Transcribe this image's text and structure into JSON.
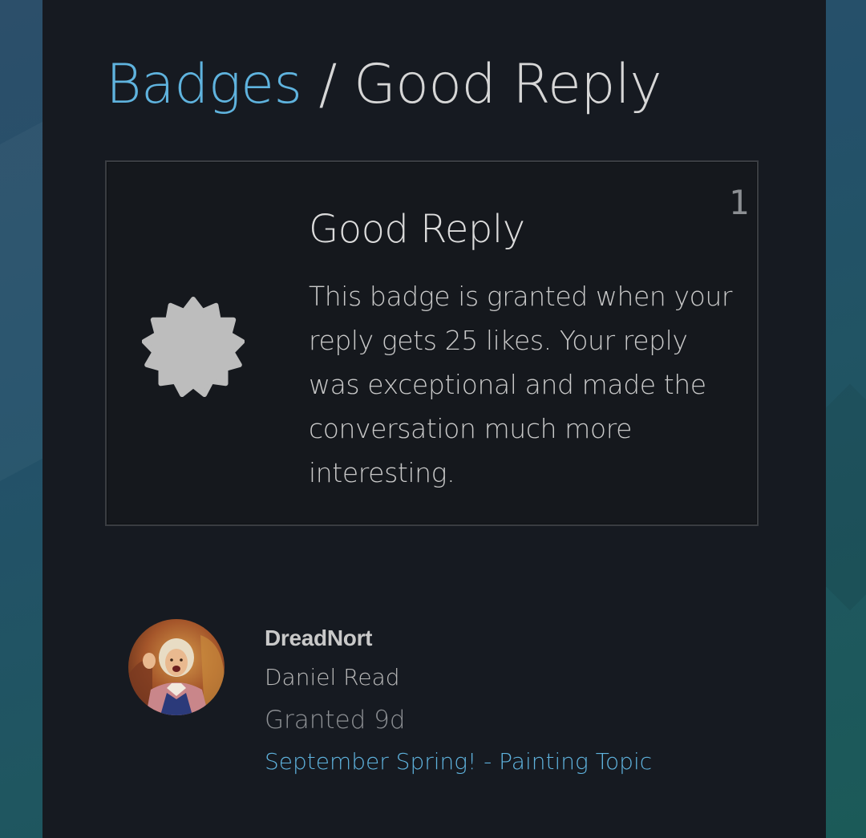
{
  "header": {
    "breadcrumb_parent": "Badges",
    "separator": " / ",
    "current": "Good Reply"
  },
  "badge": {
    "name": "Good Reply",
    "count": "1",
    "description": "This badge is granted when your reply gets 25 likes. Your reply was exceptional and made the conversation much more interesting.",
    "icon": "badge-seal-icon",
    "icon_color": "#bdbdbd"
  },
  "grant": {
    "username": "DreadNort",
    "full_name": "Daniel Read",
    "granted_text": "Granted 9d",
    "topic_link": "September Spring! - Painting Topic",
    "avatar_icon": "user-avatar"
  },
  "colors": {
    "accent": "#5fb3de",
    "panel": "#161a21",
    "text": "#d6d6d6"
  }
}
